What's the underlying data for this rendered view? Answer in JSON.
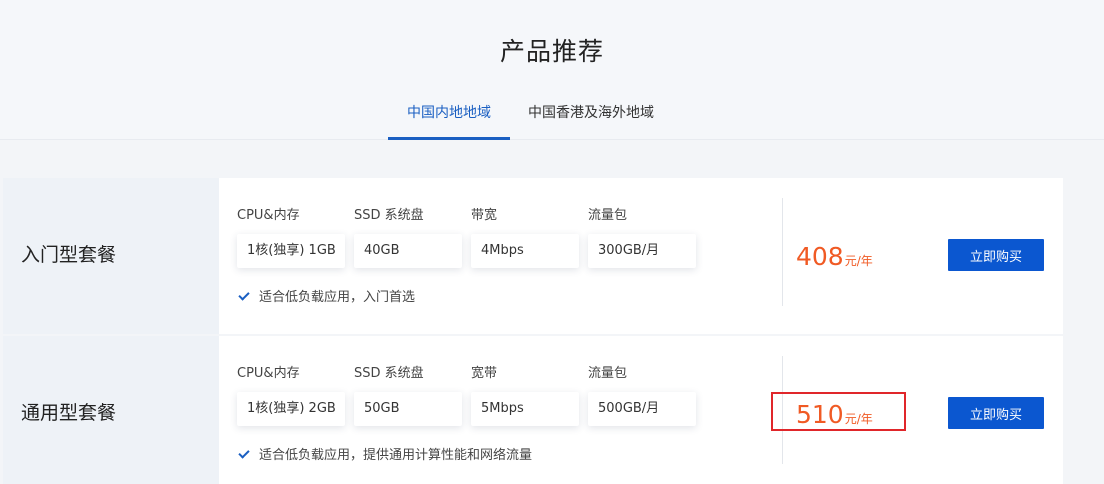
{
  "header": {
    "title": "产品推荐",
    "tabs": [
      {
        "label": "中国内地地域",
        "active": true
      },
      {
        "label": "中国香港及海外地域",
        "active": false
      }
    ]
  },
  "plans": [
    {
      "name": "入门型套餐",
      "specs": [
        {
          "label": "CPU&内存",
          "value": "1核(独享) 1GB"
        },
        {
          "label": "SSD 系统盘",
          "value": "40GB"
        },
        {
          "label": "带宽",
          "value": "4Mbps"
        },
        {
          "label": "流量包",
          "value": "300GB/月"
        }
      ],
      "note": "适合低负载应用，入门首选",
      "price": "408",
      "price_unit": "元/年",
      "buy_label": "立即购买"
    },
    {
      "name": "通用型套餐",
      "specs": [
        {
          "label": "CPU&内存",
          "value": "1核(独享) 2GB"
        },
        {
          "label": "SSD 系统盘",
          "value": "50GB"
        },
        {
          "label": "宽带",
          "value": "5Mbps"
        },
        {
          "label": "流量包",
          "value": "500GB/月"
        }
      ],
      "note": "适合低负载应用，提供通用计算性能和网络流量",
      "price": "510",
      "price_unit": "元/年",
      "buy_label": "立即购买"
    }
  ],
  "colors": {
    "accent": "#1a5fc2",
    "button": "#0b57d0",
    "price": "#f05a24",
    "highlight": "#e0262a"
  }
}
